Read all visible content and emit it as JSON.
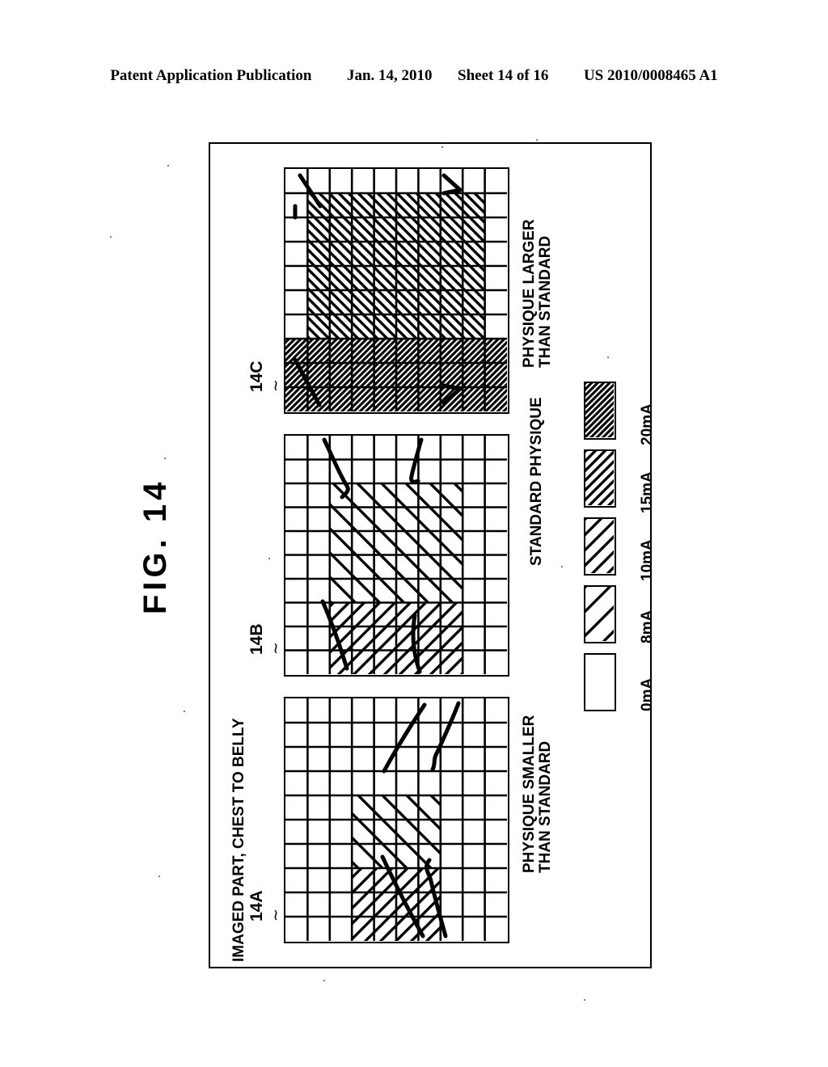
{
  "header": {
    "publication": "Patent Application Publication",
    "date": "Jan. 14, 2010",
    "sheet": "Sheet 14 of 16",
    "docnum": "US 2010/0008465 A1"
  },
  "figure": {
    "title": "FIG. 14",
    "axis_caption": "IMAGED PART, CHEST TO BELLY"
  },
  "panels": [
    {
      "code": "14A",
      "tilde": "∼",
      "caption_line1": "PHYSIQUE SMALLER",
      "caption_line2": "THAN STANDARD",
      "grid_cols": 10,
      "grid_rows": 10
    },
    {
      "code": "14B",
      "tilde": "∼",
      "caption_line1": "STANDARD PHYSIQUE",
      "caption_line2": "",
      "grid_cols": 10,
      "grid_rows": 10
    },
    {
      "code": "14C",
      "tilde": "∼",
      "caption_line1": "PHYSIQUE LARGER",
      "caption_line2": "THAN STANDARD",
      "grid_cols": 10,
      "grid_rows": 10
    }
  ],
  "legend": {
    "items": [
      {
        "label": "0mA",
        "density": 0
      },
      {
        "label": "8mA",
        "density": 1
      },
      {
        "label": "10mA",
        "density": 2
      },
      {
        "label": "15mA",
        "density": 3
      },
      {
        "label": "20mA",
        "density": 4
      }
    ]
  },
  "chart_data": {
    "type": "heatmap",
    "title": "FIG. 14",
    "xlabel": "IMAGED PART, CHEST TO BELLY",
    "ylabel": "",
    "grid": {
      "cols": 10,
      "rows": 10
    },
    "value_scale": [
      "0mA",
      "8mA",
      "10mA",
      "15mA",
      "20mA"
    ],
    "panels": [
      {
        "name": "14A",
        "condition": "PHYSIQUE SMALLER THAN STANDARD",
        "regions": [
          {
            "value": "8mA",
            "col_start": 5,
            "col_end": 7,
            "row_start": 4,
            "row_end": 7
          },
          {
            "value": "10mA",
            "col_start": 8,
            "col_end": 10,
            "row_start": 4,
            "row_end": 7
          }
        ]
      },
      {
        "name": "14B",
        "condition": "STANDARD PHYSIQUE",
        "regions": [
          {
            "value": "8mA",
            "col_start": 3,
            "col_end": 7,
            "row_start": 3,
            "row_end": 8
          },
          {
            "value": "10mA",
            "col_start": 8,
            "col_end": 10,
            "row_start": 3,
            "row_end": 8
          }
        ]
      },
      {
        "name": "14C",
        "condition": "PHYSIQUE LARGER THAN STANDARD",
        "regions": [
          {
            "value": "15mA",
            "col_start": 2,
            "col_end": 7,
            "row_start": 2,
            "row_end": 9
          },
          {
            "value": "20mA",
            "col_start": 8,
            "col_end": 10,
            "row_start": 1,
            "row_end": 10
          }
        ]
      }
    ]
  }
}
